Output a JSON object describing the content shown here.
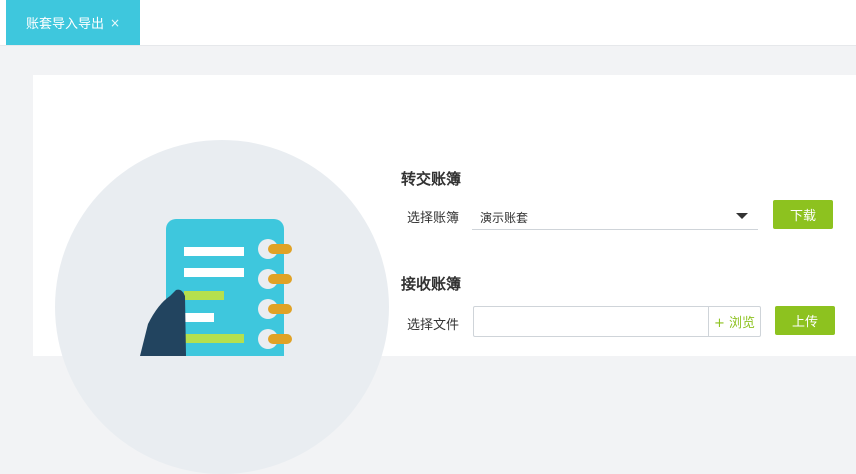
{
  "tabs": [
    {
      "label": "账套导入导出",
      "close": "×",
      "active": true
    }
  ],
  "transfer": {
    "title": "转交账簿",
    "select_label": "选择账簿",
    "selected_value": "演示账套",
    "download_label": "下载"
  },
  "receive": {
    "title": "接收账簿",
    "file_label": "选择文件",
    "file_value": "",
    "browse_label": "+ 浏览",
    "upload_label": "上传"
  },
  "colors": {
    "accent": "#3ec7dd",
    "button": "#8dc21f",
    "illustration_dark": "#22445f",
    "ring": "#e0a226",
    "stripe_green": "#b5e04e"
  },
  "icons": {
    "close": "close-icon",
    "dropdown": "chevron-down-icon",
    "illustration": "notebook-illustration"
  }
}
